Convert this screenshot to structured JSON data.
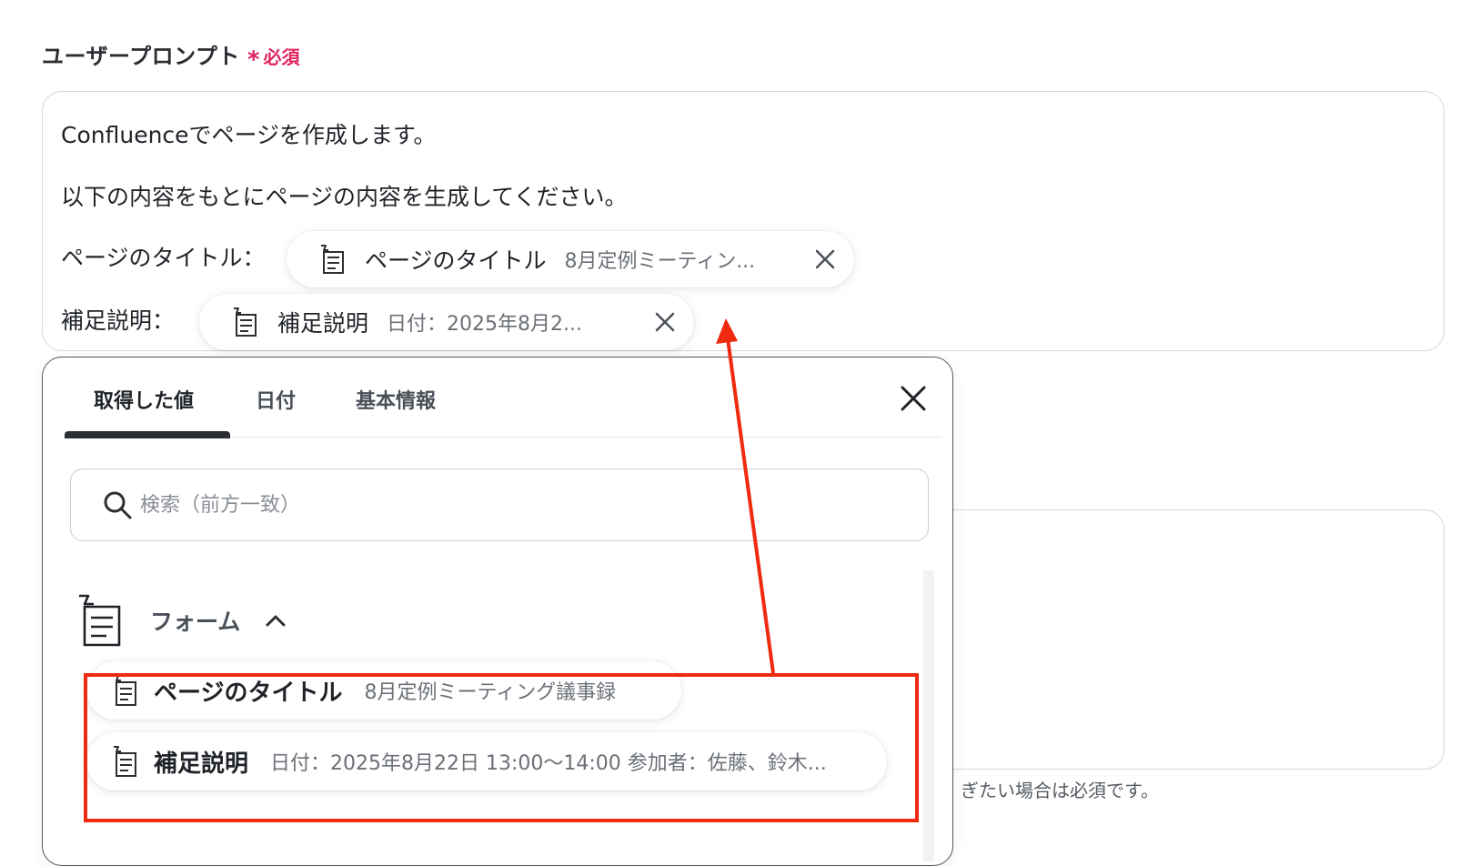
{
  "section": {
    "label": "ユーザープロンプト",
    "required_mark": "*",
    "required_text": "必須"
  },
  "prompt": {
    "line1": "Confluenceでページを作成します。",
    "line2": "以下の内容をもとにページの内容を生成してください。",
    "line3_label": "ページのタイトル：",
    "line4_label": "補足説明：",
    "chips": [
      {
        "name": "ページのタイトル",
        "value": "8月定例ミーティン..."
      },
      {
        "name": "補足説明",
        "value": "日付：2025年8月2..."
      }
    ]
  },
  "background_field": {
    "hint": "ぎたい場合は必須です。"
  },
  "popover": {
    "tabs": [
      {
        "label": "取得した値",
        "active": true
      },
      {
        "label": "日付",
        "active": false
      },
      {
        "label": "基本情報",
        "active": false
      }
    ],
    "search_placeholder": "検索（前方一致）",
    "group": {
      "name": "フォーム",
      "expanded": true,
      "items": [
        {
          "name": "ページのタイトル",
          "value": "8月定例ミーティング議事録"
        },
        {
          "name": "補足説明",
          "value": "日付：2025年8月22日 13:00〜14:00 参加者：佐藤、鈴木..."
        }
      ]
    }
  },
  "colors": {
    "required": "#e0245e",
    "annotation": "#f02a0f",
    "border": "#d3d7db"
  },
  "icons": {
    "form": "form-icon",
    "close": "close-icon",
    "search": "search-icon",
    "chevron": "chevron-up-icon"
  }
}
